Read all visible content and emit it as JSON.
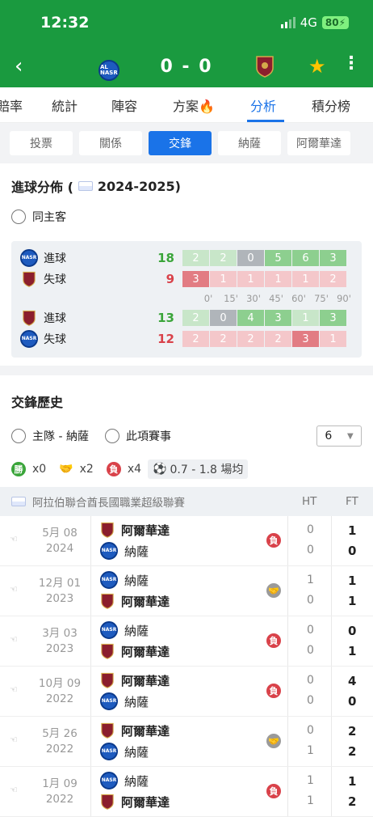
{
  "status": {
    "time": "12:32",
    "network": "4G",
    "battery": "80"
  },
  "match": {
    "score": "0 - 0",
    "home_logo_text": "AL NASR"
  },
  "tabs": [
    "賠率",
    "統計",
    "陣容",
    "方案",
    "分析",
    "積分榜"
  ],
  "active_tab": "分析",
  "subtabs": [
    "投票",
    "關係",
    "交鋒",
    "納薩",
    "阿爾華達"
  ],
  "active_subtab": "交鋒",
  "goal_dist": {
    "title": "進球分佈 (",
    "season": "2024-2025)",
    "same_venue_label": "同主客",
    "team1": [
      {
        "label": "進球",
        "total": "18",
        "cells": [
          "2",
          "2",
          "0",
          "5",
          "6",
          "3"
        ]
      },
      {
        "label": "失球",
        "total": "9",
        "cells": [
          "3",
          "1",
          "1",
          "1",
          "1",
          "2"
        ]
      }
    ],
    "ticks": [
      "0'",
      "15'",
      "30'",
      "45'",
      "60'",
      "75'",
      "90'"
    ],
    "team2": [
      {
        "label": "進球",
        "total": "13",
        "cells": [
          "2",
          "0",
          "4",
          "3",
          "1",
          "3"
        ]
      },
      {
        "label": "失球",
        "total": "12",
        "cells": [
          "2",
          "2",
          "2",
          "2",
          "3",
          "1"
        ]
      }
    ]
  },
  "h2h": {
    "title": "交鋒歷史",
    "filter_home": "主隊 - 納薩",
    "filter_comp": "此項賽事",
    "count": "6",
    "win_badge": "勝",
    "wins": "x0",
    "draws": "x2",
    "loss_badge": "負",
    "losses": "x4",
    "avg_goals": "0.7 - 1.8 場均",
    "league": "阿拉伯聯合酋長國職業超級聯賽",
    "ht_label": "HT",
    "ft_label": "FT",
    "matches": [
      {
        "date1": "5月 08",
        "date2": "2024",
        "team1": "阿爾華達",
        "team2": "納薩",
        "result": "負",
        "ht1": "0",
        "ht2": "0",
        "ft1": "1",
        "ft2": "0"
      },
      {
        "date1": "12月 01",
        "date2": "2023",
        "team1": "納薩",
        "team2": "阿爾華達",
        "result": "draw",
        "ht1": "1",
        "ht2": "0",
        "ft1": "1",
        "ft2": "1"
      },
      {
        "date1": "3月 03",
        "date2": "2023",
        "team1": "納薩",
        "team2": "阿爾華達",
        "result": "負",
        "ht1": "0",
        "ht2": "0",
        "ft1": "0",
        "ft2": "1"
      },
      {
        "date1": "10月 09",
        "date2": "2022",
        "team1": "阿爾華達",
        "team2": "納薩",
        "result": "負",
        "ht1": "0",
        "ht2": "0",
        "ft1": "4",
        "ft2": "0"
      },
      {
        "date1": "5月 26",
        "date2": "2022",
        "team1": "阿爾華達",
        "team2": "納薩",
        "result": "draw",
        "ht1": "0",
        "ht2": "1",
        "ft1": "2",
        "ft2": "2"
      },
      {
        "date1": "1月 09",
        "date2": "2022",
        "team1": "納薩",
        "team2": "阿爾華達",
        "result": "負",
        "ht1": "1",
        "ht2": "1",
        "ft1": "1",
        "ft2": "2"
      }
    ]
  },
  "colors": {
    "header": "#1a9a3f",
    "accent": "#1a73e8",
    "win": "#3aa53a",
    "loss": "#d9424a"
  }
}
